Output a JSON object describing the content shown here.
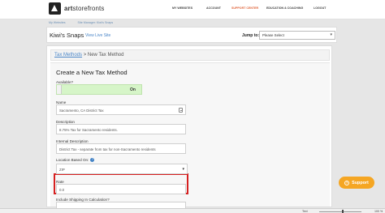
{
  "header": {
    "logo_bold": "art",
    "logo_rest": "storefronts",
    "nav": [
      "MY WEBSITES",
      "ACCOUNT",
      "SUPPORT CENTER",
      "EDUCATION & COACHING",
      "LOGOUT"
    ]
  },
  "breadcrumbs": [
    "My Websites",
    "Site Manager: Kiwi's Snaps"
  ],
  "site_bar": {
    "title": "Kiwi's Snaps",
    "view_live": "View Live Site",
    "jump_label": "Jump to:",
    "jump_value": "Please Select"
  },
  "page": {
    "crumb_link": "Tax Methods",
    "crumb_sep": " > ",
    "crumb_current": "New Tax Method",
    "form_title": "Create a New Tax Method"
  },
  "form": {
    "available_label": "Available?",
    "available_value": "On",
    "name_label": "Name",
    "name_value": "Sacramento, CA District Tax",
    "description_label": "Description",
    "description_value": "8.75% Tax for Sacramento residents.",
    "internal_label": "Internal Description",
    "internal_value": "District Tax - separate from tax for non-Sacramento residents",
    "location_label": "Location Based On:",
    "location_help": "?",
    "location_value": "ZIP",
    "rate_label": "Rate",
    "rate_value": "0.0",
    "shipping_label": "Include Shipping In Calculation?"
  },
  "support": {
    "label": "Support",
    "icon": "?"
  },
  "statusbar": {
    "left": "",
    "right": "Text",
    "zoom": "100 %"
  },
  "colors": {
    "accent": "#f5a623",
    "highlight": "#d62020",
    "toggle_on": "#d6f5c8",
    "link": "#4a86c8"
  }
}
